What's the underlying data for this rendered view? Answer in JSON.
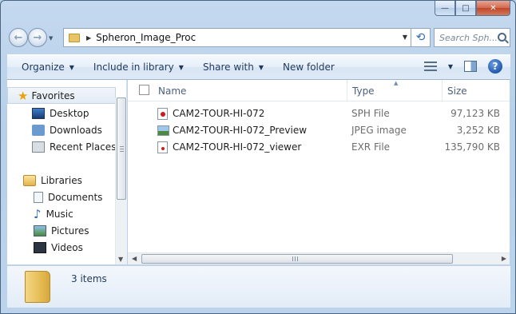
{
  "window": {
    "caption": {
      "minimize": "—",
      "maximize": "□",
      "close": "✕"
    }
  },
  "address_bar": {
    "path": "Spheron_Image_Proc",
    "search_placeholder": "Search Sph..."
  },
  "command_bar": {
    "organize": "Organize",
    "include_in_library": "Include in library",
    "share_with": "Share with",
    "new_folder": "New folder",
    "help": "?"
  },
  "nav_pane": {
    "favorites": "Favorites",
    "favorite_items": [
      "Desktop",
      "Downloads",
      "Recent Places"
    ],
    "libraries": "Libraries",
    "library_items": [
      "Documents",
      "Music",
      "Pictures",
      "Videos"
    ]
  },
  "file_list": {
    "columns": {
      "name": "Name",
      "type": "Type",
      "size": "Size"
    },
    "files": [
      {
        "name": "CAM2-TOUR-HI-072",
        "type": "SPH File",
        "size": "97,123 KB",
        "icon": "sph-file-icon"
      },
      {
        "name": "CAM2-TOUR-HI-072_Preview",
        "type": "JPEG image",
        "size": "3,252 KB",
        "icon": "jpeg-file-icon"
      },
      {
        "name": "CAM2-TOUR-HI-072_viewer",
        "type": "EXR File",
        "size": "135,790 KB",
        "icon": "exr-file-icon"
      }
    ]
  },
  "details_pane": {
    "status": "3 items"
  },
  "colors": {
    "accent": "#1e395b",
    "frame": "#b9d1ea"
  }
}
